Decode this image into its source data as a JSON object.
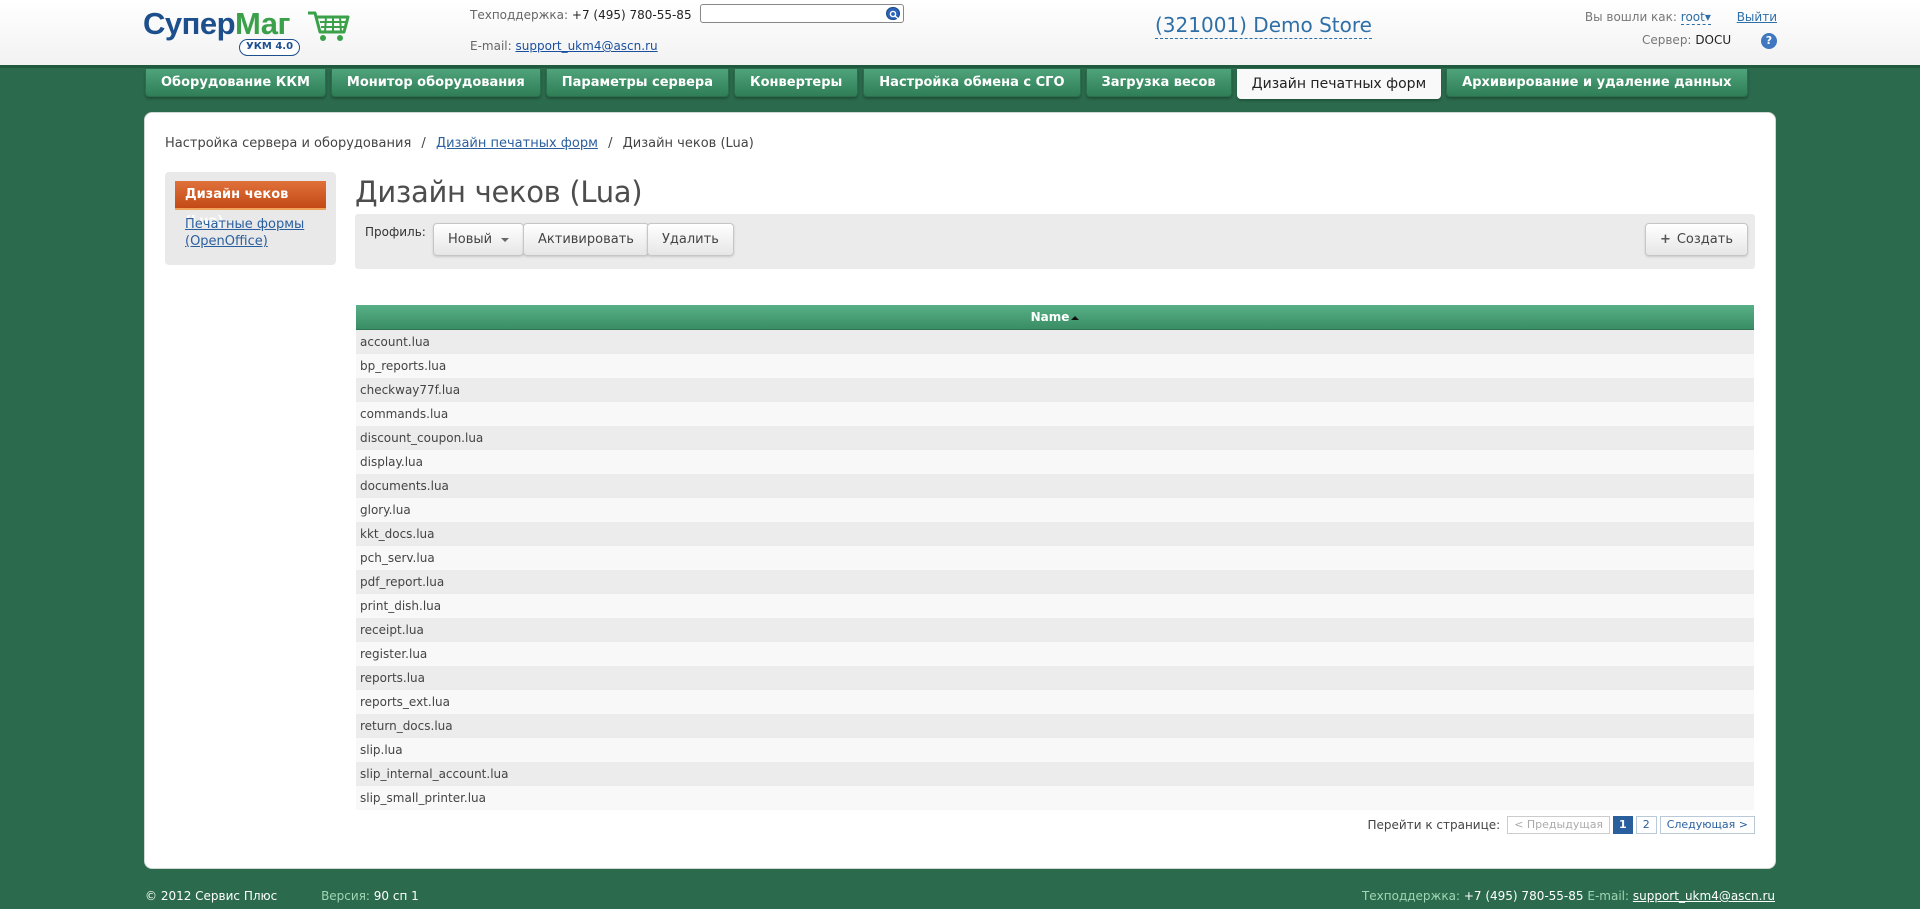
{
  "header": {
    "logo": {
      "text_1": "Супер",
      "text_2": "Маг",
      "badge": "УКМ 4.0"
    },
    "support": {
      "phone_label": "Техподдержка:",
      "phone": "+7 (495) 780-55-85",
      "email_label": "E-mail:",
      "email": "support_ukm4@ascn.ru"
    },
    "search": {
      "value": "",
      "placeholder": ""
    },
    "store": "(321001) Demo Store",
    "user": {
      "logged_in_label": "Вы вошли как:",
      "username": "root",
      "logout": "Выйти",
      "server_label": "Сервер:",
      "server": "DOCU",
      "help": "?"
    }
  },
  "tabs": [
    {
      "label": "Оборудование ККМ"
    },
    {
      "label": "Монитор оборудования"
    },
    {
      "label": "Параметры сервера"
    },
    {
      "label": "Конвертеры"
    },
    {
      "label": "Настройка обмена с СГО"
    },
    {
      "label": "Загрузка весов"
    },
    {
      "label": "Дизайн печатных форм",
      "active": true
    },
    {
      "label": "Архивирование и удаление данных"
    }
  ],
  "breadcrumb": {
    "root": "Настройка сервера и оборудования",
    "separator": "/",
    "parent": "Дизайн печатных форм",
    "current": "Дизайн чеков (Lua)"
  },
  "sidebar": {
    "active": "Дизайн чеков (Lua)",
    "link": "Печатные формы (OpenOffice)"
  },
  "page_title": "Дизайн чеков (Lua)",
  "toolbar": {
    "profile_label": "Профиль:",
    "profile_value": "Новый",
    "activate": "Активировать",
    "delete": "Удалить",
    "create": "Создать",
    "create_icon": "+"
  },
  "table": {
    "column": "Name",
    "sort": "ascending",
    "rows": [
      "account.lua",
      "bp_reports.lua",
      "checkway77f.lua",
      "commands.lua",
      "discount_coupon.lua",
      "display.lua",
      "documents.lua",
      "glory.lua",
      "kkt_docs.lua",
      "pch_serv.lua",
      "pdf_report.lua",
      "print_dish.lua",
      "receipt.lua",
      "register.lua",
      "reports.lua",
      "reports_ext.lua",
      "return_docs.lua",
      "slip.lua",
      "slip_internal_account.lua",
      "slip_small_printer.lua"
    ]
  },
  "pager": {
    "label": "Перейти к странице:",
    "prev": "< Предыдущая",
    "pages": [
      "1",
      "2"
    ],
    "current_page": "1",
    "next": "Следующая >"
  },
  "footer": {
    "copyright": "© 2012 Сервис Плюс",
    "version_label": "Версия:",
    "version": "90 сп 1",
    "phone_label": "Техподдержка:",
    "phone": "+7 (495) 780-55-85",
    "email_label": "E-mail:",
    "email": "support_ukm4@ascn.ru"
  },
  "colors": {
    "background": "#2b6a4c",
    "tab": "#3f9168",
    "accent_orange": "#d25a22",
    "link": "#2a5f9e",
    "table_header": "#48a077"
  },
  "icons": [
    "search-icon",
    "cart-icon",
    "chevron-down-icon",
    "help-icon",
    "plus-icon",
    "sort-up-icon"
  ]
}
